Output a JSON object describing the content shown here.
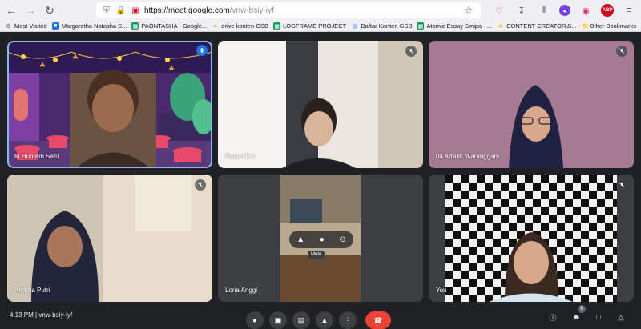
{
  "browser": {
    "url_host": "https://meet.google.com",
    "url_path": "/vnw-bsiy-iyf",
    "icons": [
      "back-icon",
      "forward-icon",
      "reload-icon",
      "shield-icon",
      "lock-icon",
      "camera-blocked-icon",
      "star-icon",
      "pocket-icon",
      "download-icon",
      "library-icon",
      "account-icon",
      "instagram-icon",
      "adblock-icon",
      "menu-icon"
    ],
    "adblock_label": "ABP"
  },
  "bookmarks": {
    "items": [
      {
        "label": "Most Visited",
        "icon": "gear-icon"
      },
      {
        "label": "Margaretha Natasha S...",
        "icon": "site-icon"
      },
      {
        "label": "PAONTASHA - Google...",
        "icon": "sheets-icon"
      },
      {
        "label": "drive konten GSB",
        "icon": "drive-icon"
      },
      {
        "label": "LOGFRAME PROJECT",
        "icon": "sheets-icon"
      },
      {
        "label": "Daftar Konten GSB",
        "icon": "docs-icon"
      },
      {
        "label": "Atomic Essay Smipa - ...",
        "icon": "sheets-icon"
      },
      {
        "label": "CONTENT CREATOR S...",
        "icon": "drive-icon"
      }
    ],
    "more": "»",
    "other": "Other Bookmarks"
  },
  "participants": [
    {
      "name": "M Humam Safi'i",
      "state": "speaking"
    },
    {
      "name": "Rafael Dei",
      "state": "muted"
    },
    {
      "name": "04 Artanti Waranggani",
      "state": "muted"
    },
    {
      "name": "Andrha Putri",
      "state": "muted"
    },
    {
      "name": "Loria Anggi",
      "state": "hover"
    },
    {
      "name": "You",
      "state": "muted"
    }
  ],
  "hover_controls": {
    "tooltip": "Mute"
  },
  "bottom_bar": {
    "time": "4:13 PM",
    "separator": "|",
    "meeting_code": "vnw-bsiy-iyf",
    "participant_count": "6"
  },
  "colors": {
    "accent": "#8ab4f8",
    "end_call": "#ea4335",
    "background": "#202124"
  }
}
